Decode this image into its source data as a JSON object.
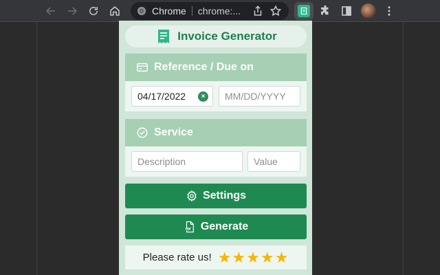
{
  "browser": {
    "omnibox_site": "Chrome",
    "omnibox_url": "chrome:...",
    "icons": [
      "back-icon",
      "forward-icon",
      "reload-icon",
      "home-icon",
      "share-icon",
      "star-icon",
      "puzzle-icon",
      "sidepanel-icon",
      "kebab-icon"
    ]
  },
  "popup": {
    "title": "Invoice Generator",
    "reference": {
      "heading": "Reference / Due on",
      "reference_value": "04/17/2022",
      "due_placeholder": "MM/DD/YYYY",
      "clear_symbol": "×"
    },
    "service": {
      "heading": "Service",
      "description_placeholder": "Description",
      "value_placeholder": "Value"
    },
    "settings_label": "Settings",
    "generate_label": "Generate",
    "rate_label": "Please rate us!",
    "rating": {
      "stars": 5,
      "max": 5,
      "symbol": "★"
    }
  },
  "colors": {
    "accent": "#1e8a52",
    "section_header": "#a6cfb4",
    "popup_bg": "#cfe6d9",
    "star": "#f5b800"
  }
}
